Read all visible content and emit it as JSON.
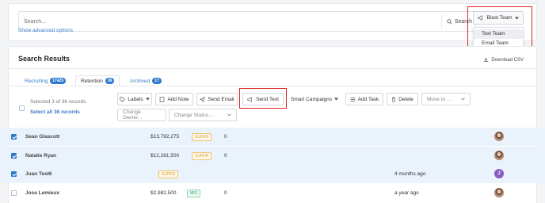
{
  "search": {
    "placeholder": "Search...",
    "button_label": "Search",
    "advanced_link": "Show advanced options"
  },
  "blast": {
    "button_label": "Blast Team",
    "options": [
      "Text Team",
      "Email Team"
    ]
  },
  "results": {
    "title": "Search Results",
    "download_label": "Download CSV",
    "tabs": [
      {
        "label": "Recruiting",
        "count": "17425"
      },
      {
        "label": "Retention",
        "count": "36"
      },
      {
        "label": "Archived",
        "count": "17"
      }
    ],
    "selection": {
      "text": "Selected 3 of 36 records",
      "select_all": "Select all 36 records"
    },
    "toolbar": {
      "labels": "Labels",
      "add_note": "Add Note",
      "send_email": "Send Email",
      "send_text": "Send Text",
      "smart_campaigns": "Smart Campaigns",
      "add_task": "Add Task",
      "delete": "Delete",
      "move_to": "Move to ...",
      "change_owner": "Change Owner...",
      "change_status": "Change Status ..."
    },
    "rows": [
      {
        "name": "Sean Glascott",
        "amount": "$13,792,275",
        "tag": "SUPER",
        "count": "0",
        "time": "",
        "avatar": "photo",
        "avatar_letter": "",
        "selected": true
      },
      {
        "name": "Natalie Ryan",
        "amount": "$12,281,500",
        "tag": "SUPER",
        "count": "0",
        "time": "",
        "avatar": "photo",
        "avatar_letter": "",
        "selected": true
      },
      {
        "name": "Juan Test6",
        "amount": "",
        "tag": "SUPER",
        "count": "",
        "time": "4 months ago",
        "avatar": "letter",
        "avatar_letter": "J",
        "selected": true
      },
      {
        "name": "Jose Lemieux",
        "amount": "$2,982,500",
        "tag": "MID",
        "count": "0",
        "time": "a year ago",
        "avatar": "photo",
        "avatar_letter": "",
        "selected": false
      }
    ]
  },
  "colors": {
    "accent": "#2f7ad0",
    "highlight_box": "#e02020",
    "selected_row": "#eaf3fb"
  }
}
